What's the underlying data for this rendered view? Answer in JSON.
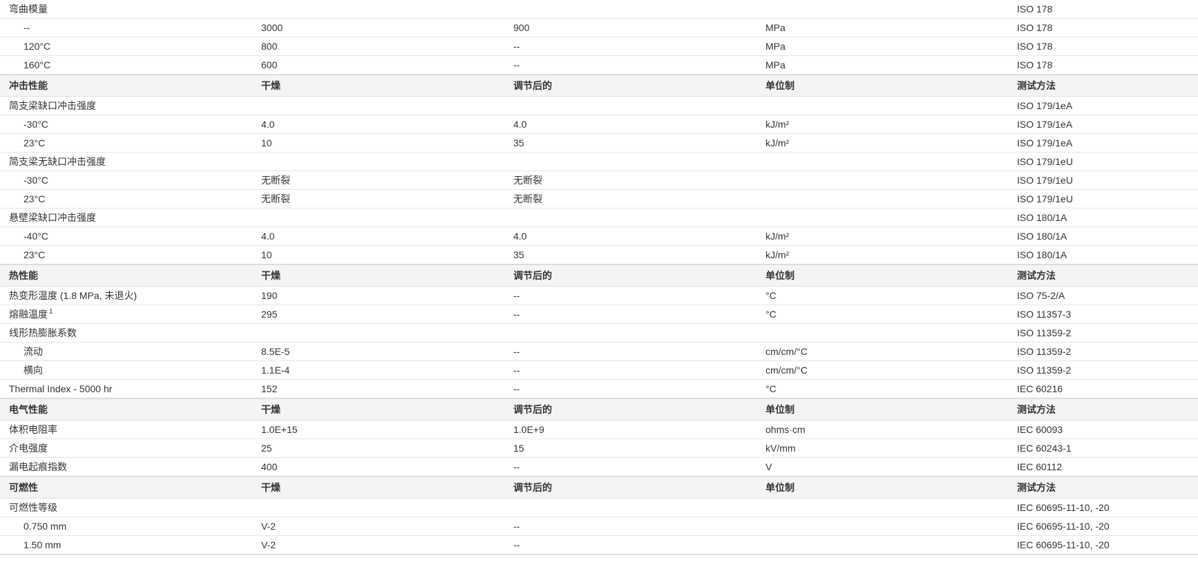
{
  "headers": {
    "value1": "干燥",
    "value2": "调节后的",
    "unit": "单位制",
    "method": "测试方法"
  },
  "sections": [
    {
      "title": null,
      "rows": [
        {
          "prop": "弯曲模量",
          "v1": "",
          "v2": "",
          "unit": "",
          "method": "ISO 178",
          "indent": false
        },
        {
          "prop": "--",
          "v1": "3000",
          "v2": "900",
          "unit": "MPa",
          "method": "ISO 178",
          "indent": true
        },
        {
          "prop": "120°C",
          "v1": "800",
          "v2": "--",
          "unit": "MPa",
          "method": "ISO 178",
          "indent": true
        },
        {
          "prop": "160°C",
          "v1": "600",
          "v2": "--",
          "unit": "MPa",
          "method": "ISO 178",
          "indent": true
        }
      ]
    },
    {
      "title": "冲击性能",
      "rows": [
        {
          "prop": "简支梁缺口冲击强度",
          "v1": "",
          "v2": "",
          "unit": "",
          "method": "ISO 179/1eA",
          "indent": false
        },
        {
          "prop": "-30°C",
          "v1": "4.0",
          "v2": "4.0",
          "unit": "kJ/m²",
          "method": "ISO 179/1eA",
          "indent": true
        },
        {
          "prop": "23°C",
          "v1": "10",
          "v2": "35",
          "unit": "kJ/m²",
          "method": "ISO 179/1eA",
          "indent": true
        },
        {
          "prop": "简支梁无缺口冲击强度",
          "v1": "",
          "v2": "",
          "unit": "",
          "method": "ISO 179/1eU",
          "indent": false
        },
        {
          "prop": "-30°C",
          "v1": "无断裂",
          "v2": "无断裂",
          "unit": "",
          "method": "ISO 179/1eU",
          "indent": true
        },
        {
          "prop": "23°C",
          "v1": "无断裂",
          "v2": "无断裂",
          "unit": "",
          "method": "ISO 179/1eU",
          "indent": true
        },
        {
          "prop": "悬壁梁缺口冲击强度",
          "v1": "",
          "v2": "",
          "unit": "",
          "method": "ISO 180/1A",
          "indent": false
        },
        {
          "prop": "-40°C",
          "v1": "4.0",
          "v2": "4.0",
          "unit": "kJ/m²",
          "method": "ISO 180/1A",
          "indent": true
        },
        {
          "prop": "23°C",
          "v1": "10",
          "v2": "35",
          "unit": "kJ/m²",
          "method": "ISO 180/1A",
          "indent": true
        }
      ]
    },
    {
      "title": "热性能",
      "rows": [
        {
          "prop": "热变形温度 (1.8 MPa, 未退火)",
          "v1": "190",
          "v2": "--",
          "unit": "°C",
          "method": "ISO 75-2/A",
          "indent": false
        },
        {
          "prop": "熔融温度",
          "footnote": "1",
          "v1": "295",
          "v2": "--",
          "unit": "°C",
          "method": "ISO 11357-3",
          "indent": false
        },
        {
          "prop": "线形热膨胀系数",
          "v1": "",
          "v2": "",
          "unit": "",
          "method": "ISO 11359-2",
          "indent": false
        },
        {
          "prop": "流动",
          "v1": "8.5E-5",
          "v2": "--",
          "unit": "cm/cm/°C",
          "method": "ISO 11359-2",
          "indent": true
        },
        {
          "prop": "横向",
          "v1": "1.1E-4",
          "v2": "--",
          "unit": "cm/cm/°C",
          "method": "ISO 11359-2",
          "indent": true
        },
        {
          "prop": "Thermal Index - 5000 hr",
          "v1": "152",
          "v2": "--",
          "unit": "°C",
          "method": "IEC 60216",
          "indent": false
        }
      ]
    },
    {
      "title": "电气性能",
      "rows": [
        {
          "prop": "体积电阻率",
          "v1": "1.0E+15",
          "v2": "1.0E+9",
          "unit": "ohms·cm",
          "method": "IEC 60093",
          "indent": false
        },
        {
          "prop": "介电强度",
          "v1": "25",
          "v2": "15",
          "unit": "kV/mm",
          "method": "IEC 60243-1",
          "indent": false
        },
        {
          "prop": "漏电起痕指数",
          "v1": "400",
          "v2": "--",
          "unit": "V",
          "method": "IEC 60112",
          "indent": false
        }
      ]
    },
    {
      "title": "可燃性",
      "rows": [
        {
          "prop": "可燃性等级",
          "v1": "",
          "v2": "",
          "unit": "",
          "method": "IEC 60695-11-10, -20",
          "indent": false
        },
        {
          "prop": "0.750 mm",
          "v1": "V-2",
          "v2": "--",
          "unit": "",
          "method": "IEC 60695-11-10, -20",
          "indent": true
        },
        {
          "prop": "1.50 mm",
          "v1": "V-2",
          "v2": "--",
          "unit": "",
          "method": "IEC 60695-11-10, -20",
          "indent": true
        }
      ]
    }
  ]
}
